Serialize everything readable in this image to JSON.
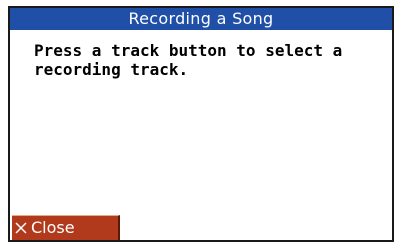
{
  "dialog": {
    "title": "Recording a Song",
    "message": "Press a track button to select a\nrecording track.",
    "close_label": "Close",
    "close_icon": "close-icon"
  },
  "colors": {
    "title_bar": "#1f4fa6",
    "close_button": "#b13a1d",
    "border": "#1a1a1a"
  }
}
